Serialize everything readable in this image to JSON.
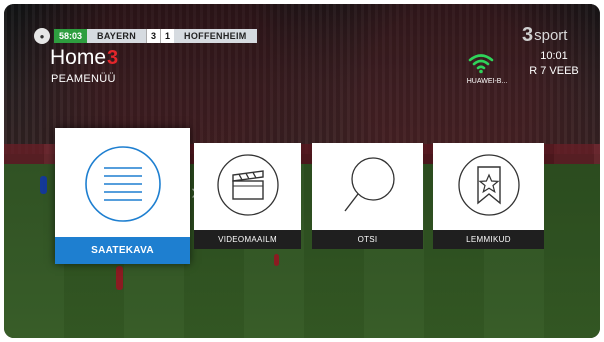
{
  "scorebug": {
    "time": "58:03",
    "home_team": "BAYERN",
    "home_score": "3",
    "away_score": "1",
    "away_team": "HOFFENHEIM"
  },
  "header": {
    "brand": "Home",
    "brand_mark": "3",
    "menu_title": "PEAMENÜÜ",
    "channel_logo_mark": "3",
    "channel_logo_text": "sport"
  },
  "status": {
    "wifi_name": "HUAWEI-B...",
    "time": "10:01",
    "date": "R 7 VEEB"
  },
  "tiles": [
    {
      "label": "SAATEKAVA",
      "icon": "guide-list-icon",
      "selected": true
    },
    {
      "label": "VIDEOMAAILM",
      "icon": "clapperboard-icon",
      "selected": false
    },
    {
      "label": "OTSI",
      "icon": "search-icon",
      "selected": false
    },
    {
      "label": "LEMMIKUD",
      "icon": "star-bookmark-icon",
      "selected": false
    }
  ],
  "colors": {
    "accent": "#1e7fd0",
    "brand_red": "#e3262b",
    "wifi_green": "#2fd45a",
    "caption_dark": "#1f1f1f"
  }
}
